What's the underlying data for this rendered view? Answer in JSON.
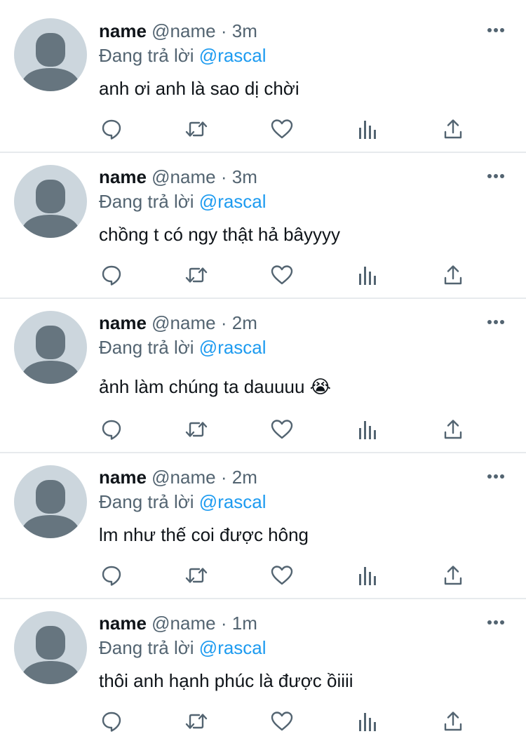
{
  "colors": {
    "text": "#0f1419",
    "secondary": "#536471",
    "accent": "#1d9bf0",
    "avatar_bg": "#ccd6dd",
    "divider": "#e7eaed"
  },
  "icons": {
    "reply": "reply-icon",
    "retweet": "retweet-icon",
    "like": "like-icon",
    "analytics": "analytics-icon",
    "share": "share-icon",
    "more": "more-icon"
  },
  "tweets": [
    {
      "name": "name",
      "handle": "@name",
      "sep": "·",
      "time": "3m",
      "reply_prefix": "Đang trả lời",
      "mention": "@rascal",
      "text": "anh ơi anh là sao dị chời"
    },
    {
      "name": "name",
      "handle": "@name",
      "sep": "·",
      "time": "3m",
      "reply_prefix": "Đang trả lời",
      "mention": "@rascal",
      "text": "chồng t có ngy thật hả bâyyyy"
    },
    {
      "name": "name",
      "handle": "@name",
      "sep": "·",
      "time": "2m",
      "reply_prefix": "Đang trả lời",
      "mention": "@rascal",
      "text": "ảnh làm chúng ta dauuuu 😭"
    },
    {
      "name": "name",
      "handle": "@name",
      "sep": "·",
      "time": "2m",
      "reply_prefix": "Đang trả lời",
      "mention": "@rascal",
      "text": "lm như thế coi được hông"
    },
    {
      "name": "name",
      "handle": "@name",
      "sep": "·",
      "time": "1m",
      "reply_prefix": "Đang trả lời",
      "mention": "@rascal",
      "text": "thôi anh hạnh phúc là được ồiiii"
    }
  ]
}
